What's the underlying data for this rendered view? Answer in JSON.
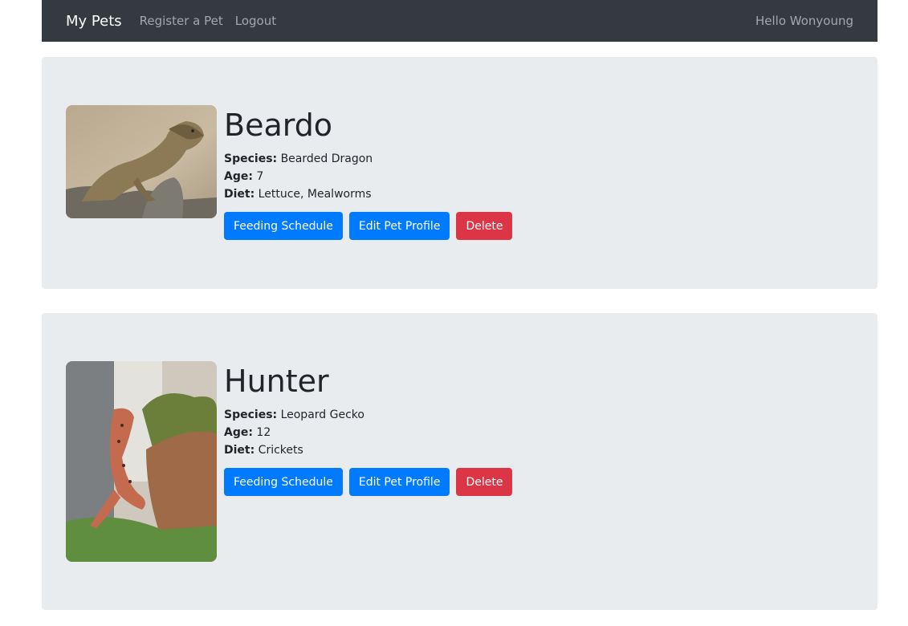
{
  "nav": {
    "brand": "My Pets",
    "links": [
      "Register a Pet",
      "Logout"
    ],
    "greeting": "Hello Wonyoung"
  },
  "labels": {
    "species": "Species:",
    "age": "Age:",
    "diet": "Diet:"
  },
  "buttons": {
    "feeding": "Feeding Schedule",
    "edit": "Edit Pet Profile",
    "delete": "Delete"
  },
  "pets": [
    {
      "name": "Beardo",
      "species": "Bearded Dragon",
      "age": "7",
      "diet": "Lettuce, Mealworms",
      "photo": "bearded-dragon-photo"
    },
    {
      "name": "Hunter",
      "species": "Leopard Gecko",
      "age": "12",
      "diet": "Crickets",
      "photo": "leopard-gecko-photo"
    }
  ],
  "colors": {
    "navbar": "#343a40",
    "card": "#e9ecef",
    "primary": "#007bff",
    "danger": "#dc3545"
  }
}
